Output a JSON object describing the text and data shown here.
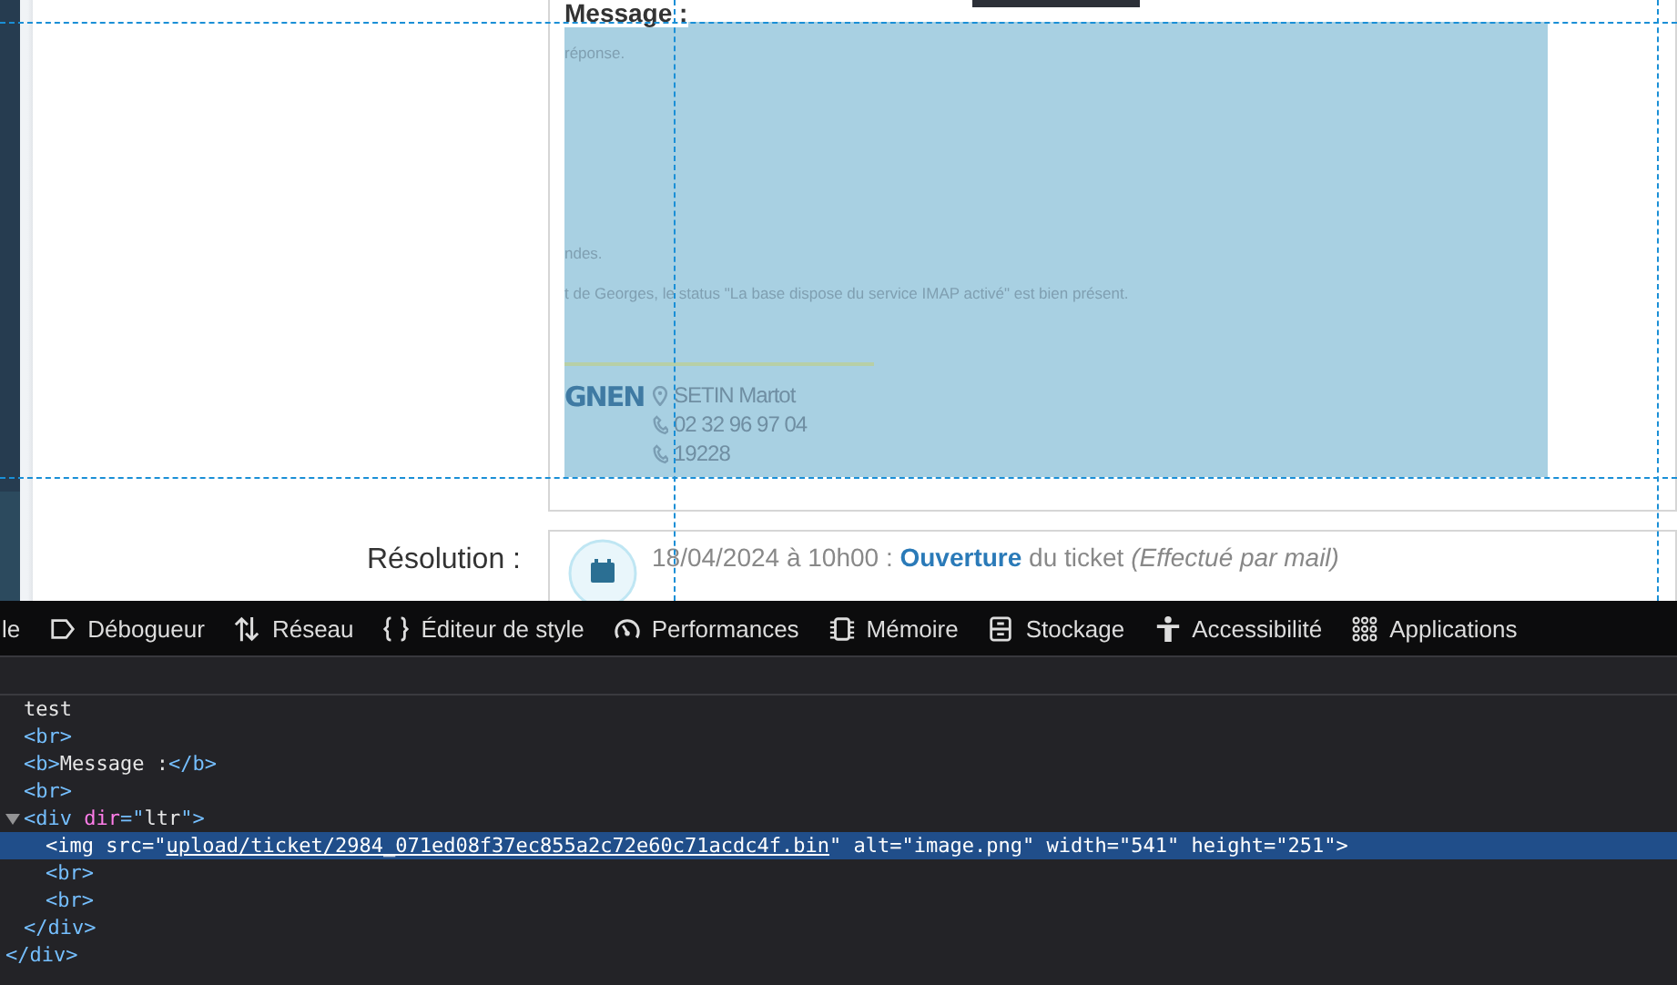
{
  "page": {
    "message_label": "Message :",
    "email": {
      "lines": [
        "réponse.",
        "ndes.",
        "t de Georges, le status \"La base dispose du service IMAP activé\" est bien présent."
      ],
      "logo_text": "GNEN",
      "contacts": [
        {
          "kind": "pin",
          "text": "SETIN Martot"
        },
        {
          "kind": "phone",
          "text": "02 32 96 97 04"
        },
        {
          "kind": "phone",
          "text": "19228"
        }
      ]
    },
    "resolution_label": "Résolution :",
    "event": "18/04/2024 à 10h00 : **Ouverture** du ticket *(Effectué par mail)*"
  },
  "devtools": {
    "tabs": [
      {
        "label": "le",
        "kind": "none"
      },
      {
        "label": "Débogueur",
        "kind": "debugger"
      },
      {
        "label": "Réseau",
        "kind": "network"
      },
      {
        "label": "Éditeur de style",
        "kind": "braces"
      },
      {
        "label": "Performances",
        "kind": "gauge"
      },
      {
        "label": "Mémoire",
        "kind": "chip"
      },
      {
        "label": "Stockage",
        "kind": "storage"
      },
      {
        "label": "Accessibilité",
        "kind": "person"
      },
      {
        "label": "Applications",
        "kind": "grid"
      }
    ],
    "markup": {
      "nodes": [
        {
          "selected": false,
          "tokens": [
            {
              "kind": "text",
              "text": "test"
            }
          ]
        },
        {
          "selected": false,
          "tokens": [
            {
              "kind": "tag",
              "text": "<br>"
            }
          ]
        },
        {
          "selected": false,
          "tokens": [
            {
              "kind": "tag",
              "text": "<b>"
            },
            {
              "kind": "text",
              "text": "Message :"
            },
            {
              "kind": "tag",
              "text": "</b>"
            }
          ]
        },
        {
          "selected": false,
          "tokens": [
            {
              "kind": "tag",
              "text": "<br>"
            }
          ]
        },
        {
          "selected": false,
          "expanded": true,
          "tokens": [
            {
              "kind": "tag",
              "text": "<div"
            },
            {
              "kind": "attr",
              "text": " dir"
            },
            {
              "kind": "tag",
              "text": "=\""
            },
            {
              "kind": "value",
              "text": "ltr"
            },
            {
              "kind": "tag",
              "text": "\">"
            }
          ],
          "children": [
            {
              "selected": true,
              "tokens": [
                {
                  "kind": "tag",
                  "text": "<img"
                },
                {
                  "kind": "attr",
                  "text": " src"
                },
                {
                  "kind": "tag",
                  "text": "=\""
                },
                {
                  "kind": "link",
                  "text": "upload/ticket/2984_071ed08f37ec855a2c72e60c71acdc4f.bin"
                },
                {
                  "kind": "tag",
                  "text": "\""
                },
                {
                  "kind": "attr",
                  "text": " alt"
                },
                {
                  "kind": "tag",
                  "text": "=\""
                },
                {
                  "kind": "value",
                  "text": "image.png"
                },
                {
                  "kind": "tag",
                  "text": "\""
                },
                {
                  "kind": "attr",
                  "text": " width"
                },
                {
                  "kind": "tag",
                  "text": "=\""
                },
                {
                  "kind": "value",
                  "text": "541"
                },
                {
                  "kind": "tag",
                  "text": "\""
                },
                {
                  "kind": "attr",
                  "text": " height"
                },
                {
                  "kind": "tag",
                  "text": "=\""
                },
                {
                  "kind": "value",
                  "text": "251"
                },
                {
                  "kind": "tag",
                  "text": "\">"
                }
              ]
            },
            {
              "selected": false,
              "tokens": [
                {
                  "kind": "tag",
                  "text": "<br>"
                }
              ]
            },
            {
              "selected": false,
              "tokens": [
                {
                  "kind": "tag",
                  "text": "<br>"
                }
              ]
            }
          ],
          "closing": "</div>"
        }
      ],
      "closing": "</div>"
    }
  }
}
